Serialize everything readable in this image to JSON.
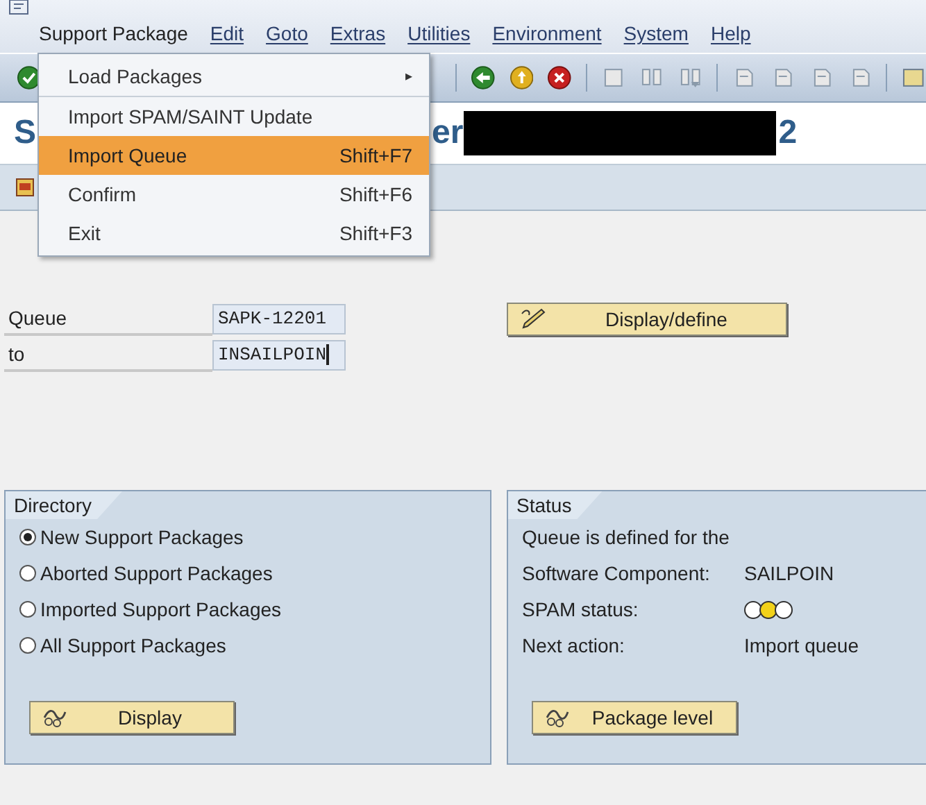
{
  "menu_bar": [
    {
      "label": "Support Package",
      "selected": true
    },
    {
      "label": "Edit",
      "selected": false
    },
    {
      "label": "Goto",
      "selected": false
    },
    {
      "label": "Extras",
      "selected": false
    },
    {
      "label": "Utilities",
      "selected": false
    },
    {
      "label": "Environment",
      "selected": false
    },
    {
      "label": "System",
      "selected": false
    },
    {
      "label": "Help",
      "selected": false
    }
  ],
  "dropdown_menu": [
    {
      "label": "Load Packages",
      "submenu": "▸",
      "selected": false,
      "separator_after": true
    },
    {
      "label": "Import SPAM/SAINT Update",
      "selected": false
    },
    {
      "label": "Import Queue",
      "shortcut": "Shift+F7",
      "selected": true
    },
    {
      "label": "Confirm",
      "shortcut": "Shift+F6",
      "selected": false
    },
    {
      "label": "Exit",
      "shortcut": "Shift+F3",
      "selected": false
    }
  ],
  "title_fragments": [
    "S",
    "er",
    "2"
  ],
  "form": {
    "fields": [
      {
        "label": "Queue",
        "value": "SAPK-12201"
      },
      {
        "label": "to",
        "value": "INSAILPOIN",
        "focused": true
      }
    ],
    "define_button": "Display/define"
  },
  "directory": {
    "title": "Directory",
    "options": [
      {
        "label": "New Support Packages",
        "selected": true
      },
      {
        "label": "Aborted Support Packages",
        "selected": false
      },
      {
        "label": "Imported Support Packages",
        "selected": false
      },
      {
        "label": "All Support Packages",
        "selected": false
      }
    ],
    "button": "Display"
  },
  "status": {
    "title": "Status",
    "intro": "Queue is defined for the",
    "rows": [
      {
        "label": "Software Component:",
        "value": "SAILPOIN"
      },
      {
        "label": "SPAM status:",
        "lights": [
          {
            "color": "#ffffff"
          },
          {
            "color": "#f2d21a"
          },
          {
            "color": "#ffffff"
          }
        ]
      },
      {
        "label": "Next action:",
        "value": "Import queue"
      }
    ],
    "button": "Package level"
  }
}
